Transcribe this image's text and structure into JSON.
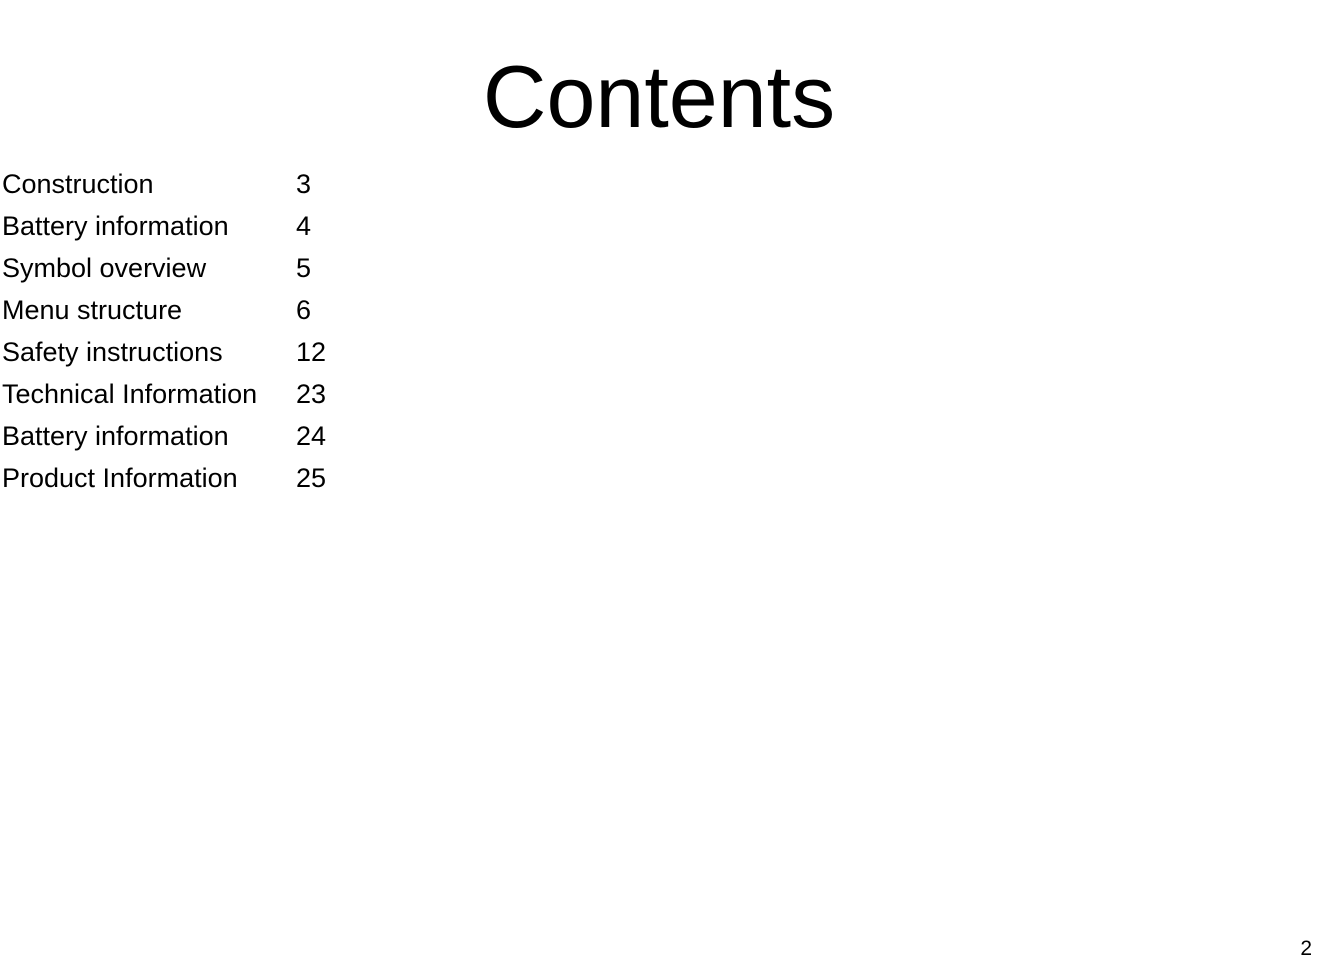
{
  "document": {
    "title": "Contents",
    "page_number": "2",
    "background_color": "#ffffff",
    "text_color": "#000000"
  },
  "contents": {
    "entries": [
      {
        "label": "Construction",
        "page": "3"
      },
      {
        "label": "Battery information",
        "page": "4"
      },
      {
        "label": "Symbol overview",
        "page": "5"
      },
      {
        "label": "Menu structure",
        "page": "6"
      },
      {
        "label": "Safety instructions",
        "page": "12"
      },
      {
        "label": "Technical Information",
        "page": "23"
      },
      {
        "label": "Battery information",
        "page": "24"
      },
      {
        "label": "Product Information",
        "page": "25"
      }
    ]
  }
}
